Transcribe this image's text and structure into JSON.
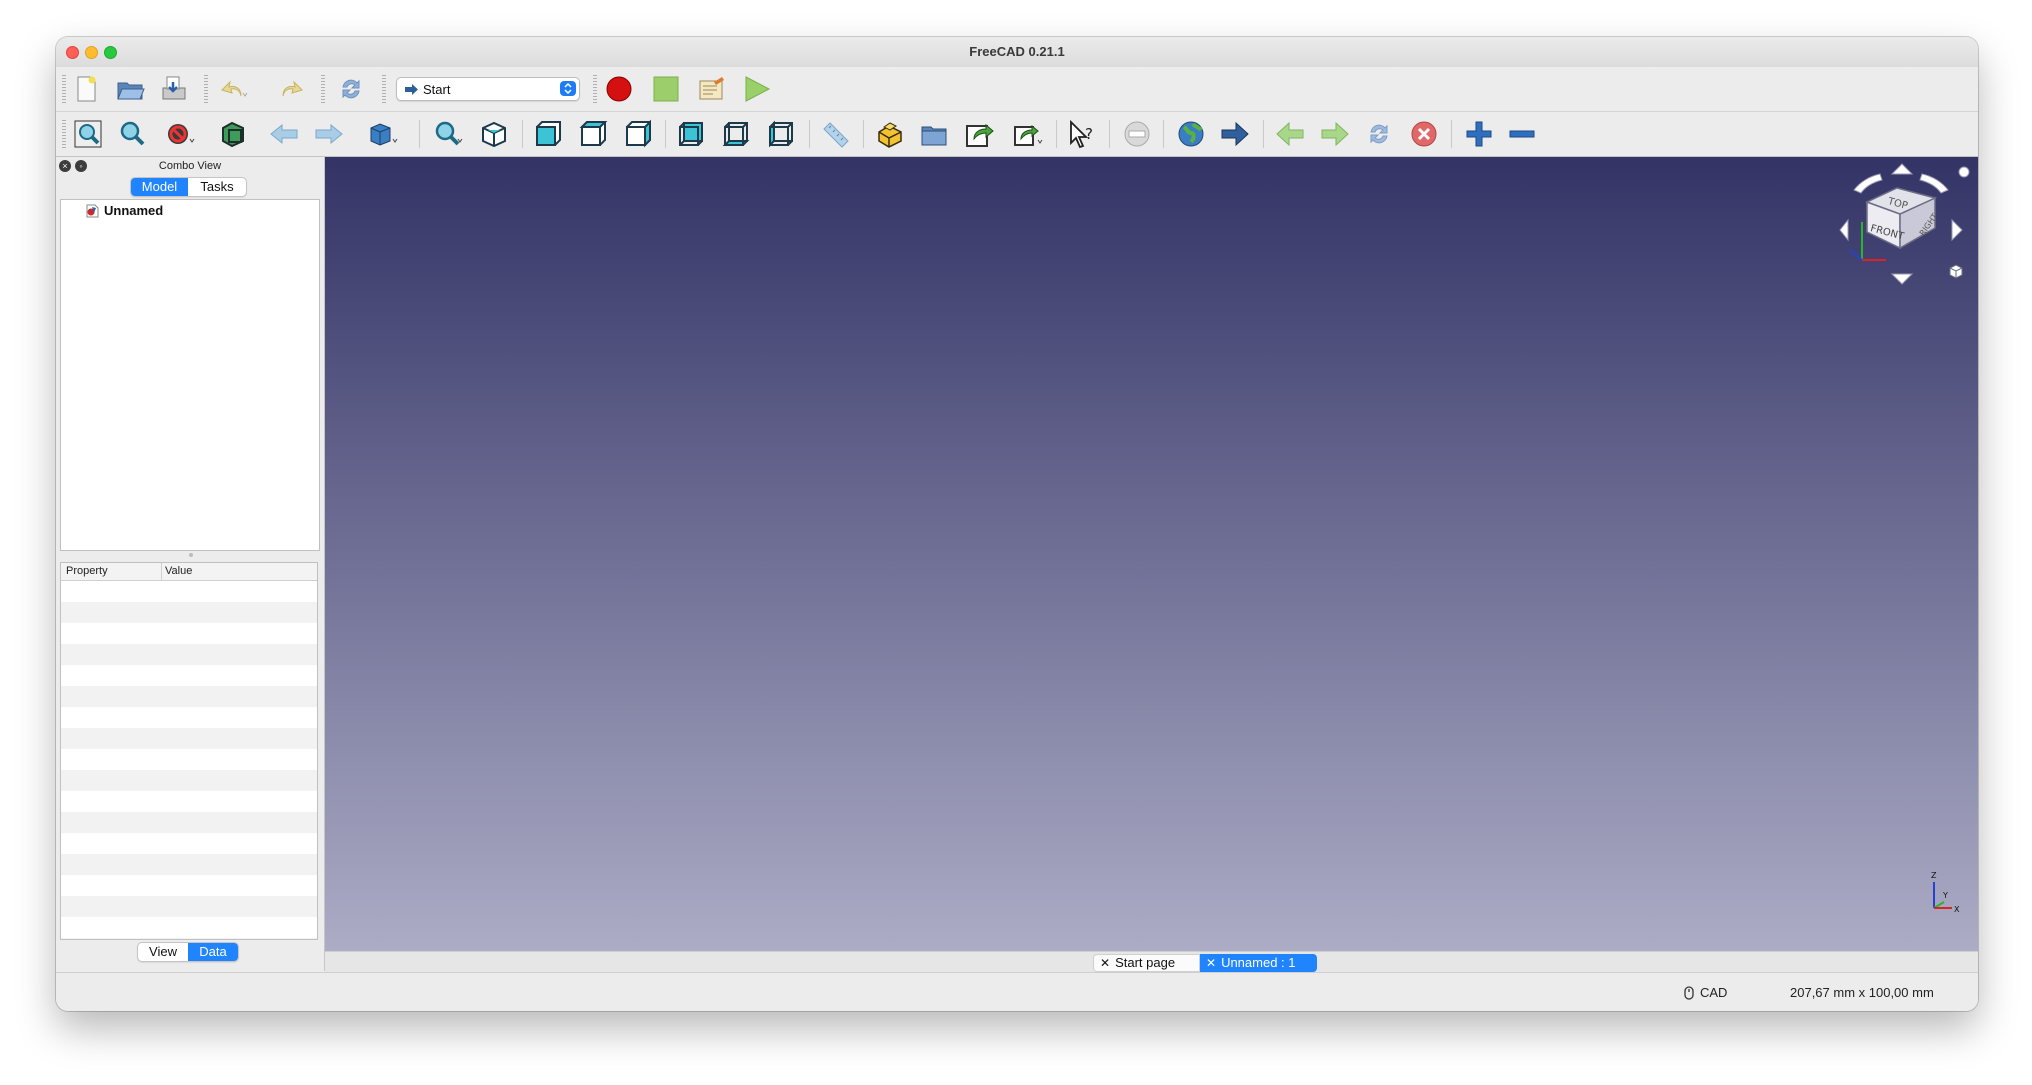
{
  "window": {
    "title": "FreeCAD 0.21.1"
  },
  "toolbar1": {
    "workbench": {
      "selected": "Start"
    }
  },
  "combo_view": {
    "title": "Combo View",
    "tabs": [
      "Model",
      "Tasks"
    ],
    "active_tab": "Model",
    "tree": [
      {
        "label": "Unnamed"
      }
    ],
    "property_columns": [
      "Property",
      "Value"
    ],
    "bottom_tabs": [
      "View",
      "Data"
    ],
    "active_bottom_tab": "Data"
  },
  "document_tabs": [
    {
      "label": "Start page",
      "active": false
    },
    {
      "label": "Unnamed : 1",
      "active": true
    }
  ],
  "status_bar": {
    "navigation_style": "CAD",
    "dimensions": "207,67 mm x 100,00 mm"
  },
  "navigation_cube": {
    "faces": [
      "TOP",
      "FRONT",
      "RIGHT"
    ]
  },
  "axis_indicator": {
    "labels": [
      "Z",
      "Y",
      "X"
    ]
  },
  "colors": {
    "viewport_top": "#333366",
    "viewport_bottom": "#acacc6",
    "accent": "#1f84fd"
  }
}
